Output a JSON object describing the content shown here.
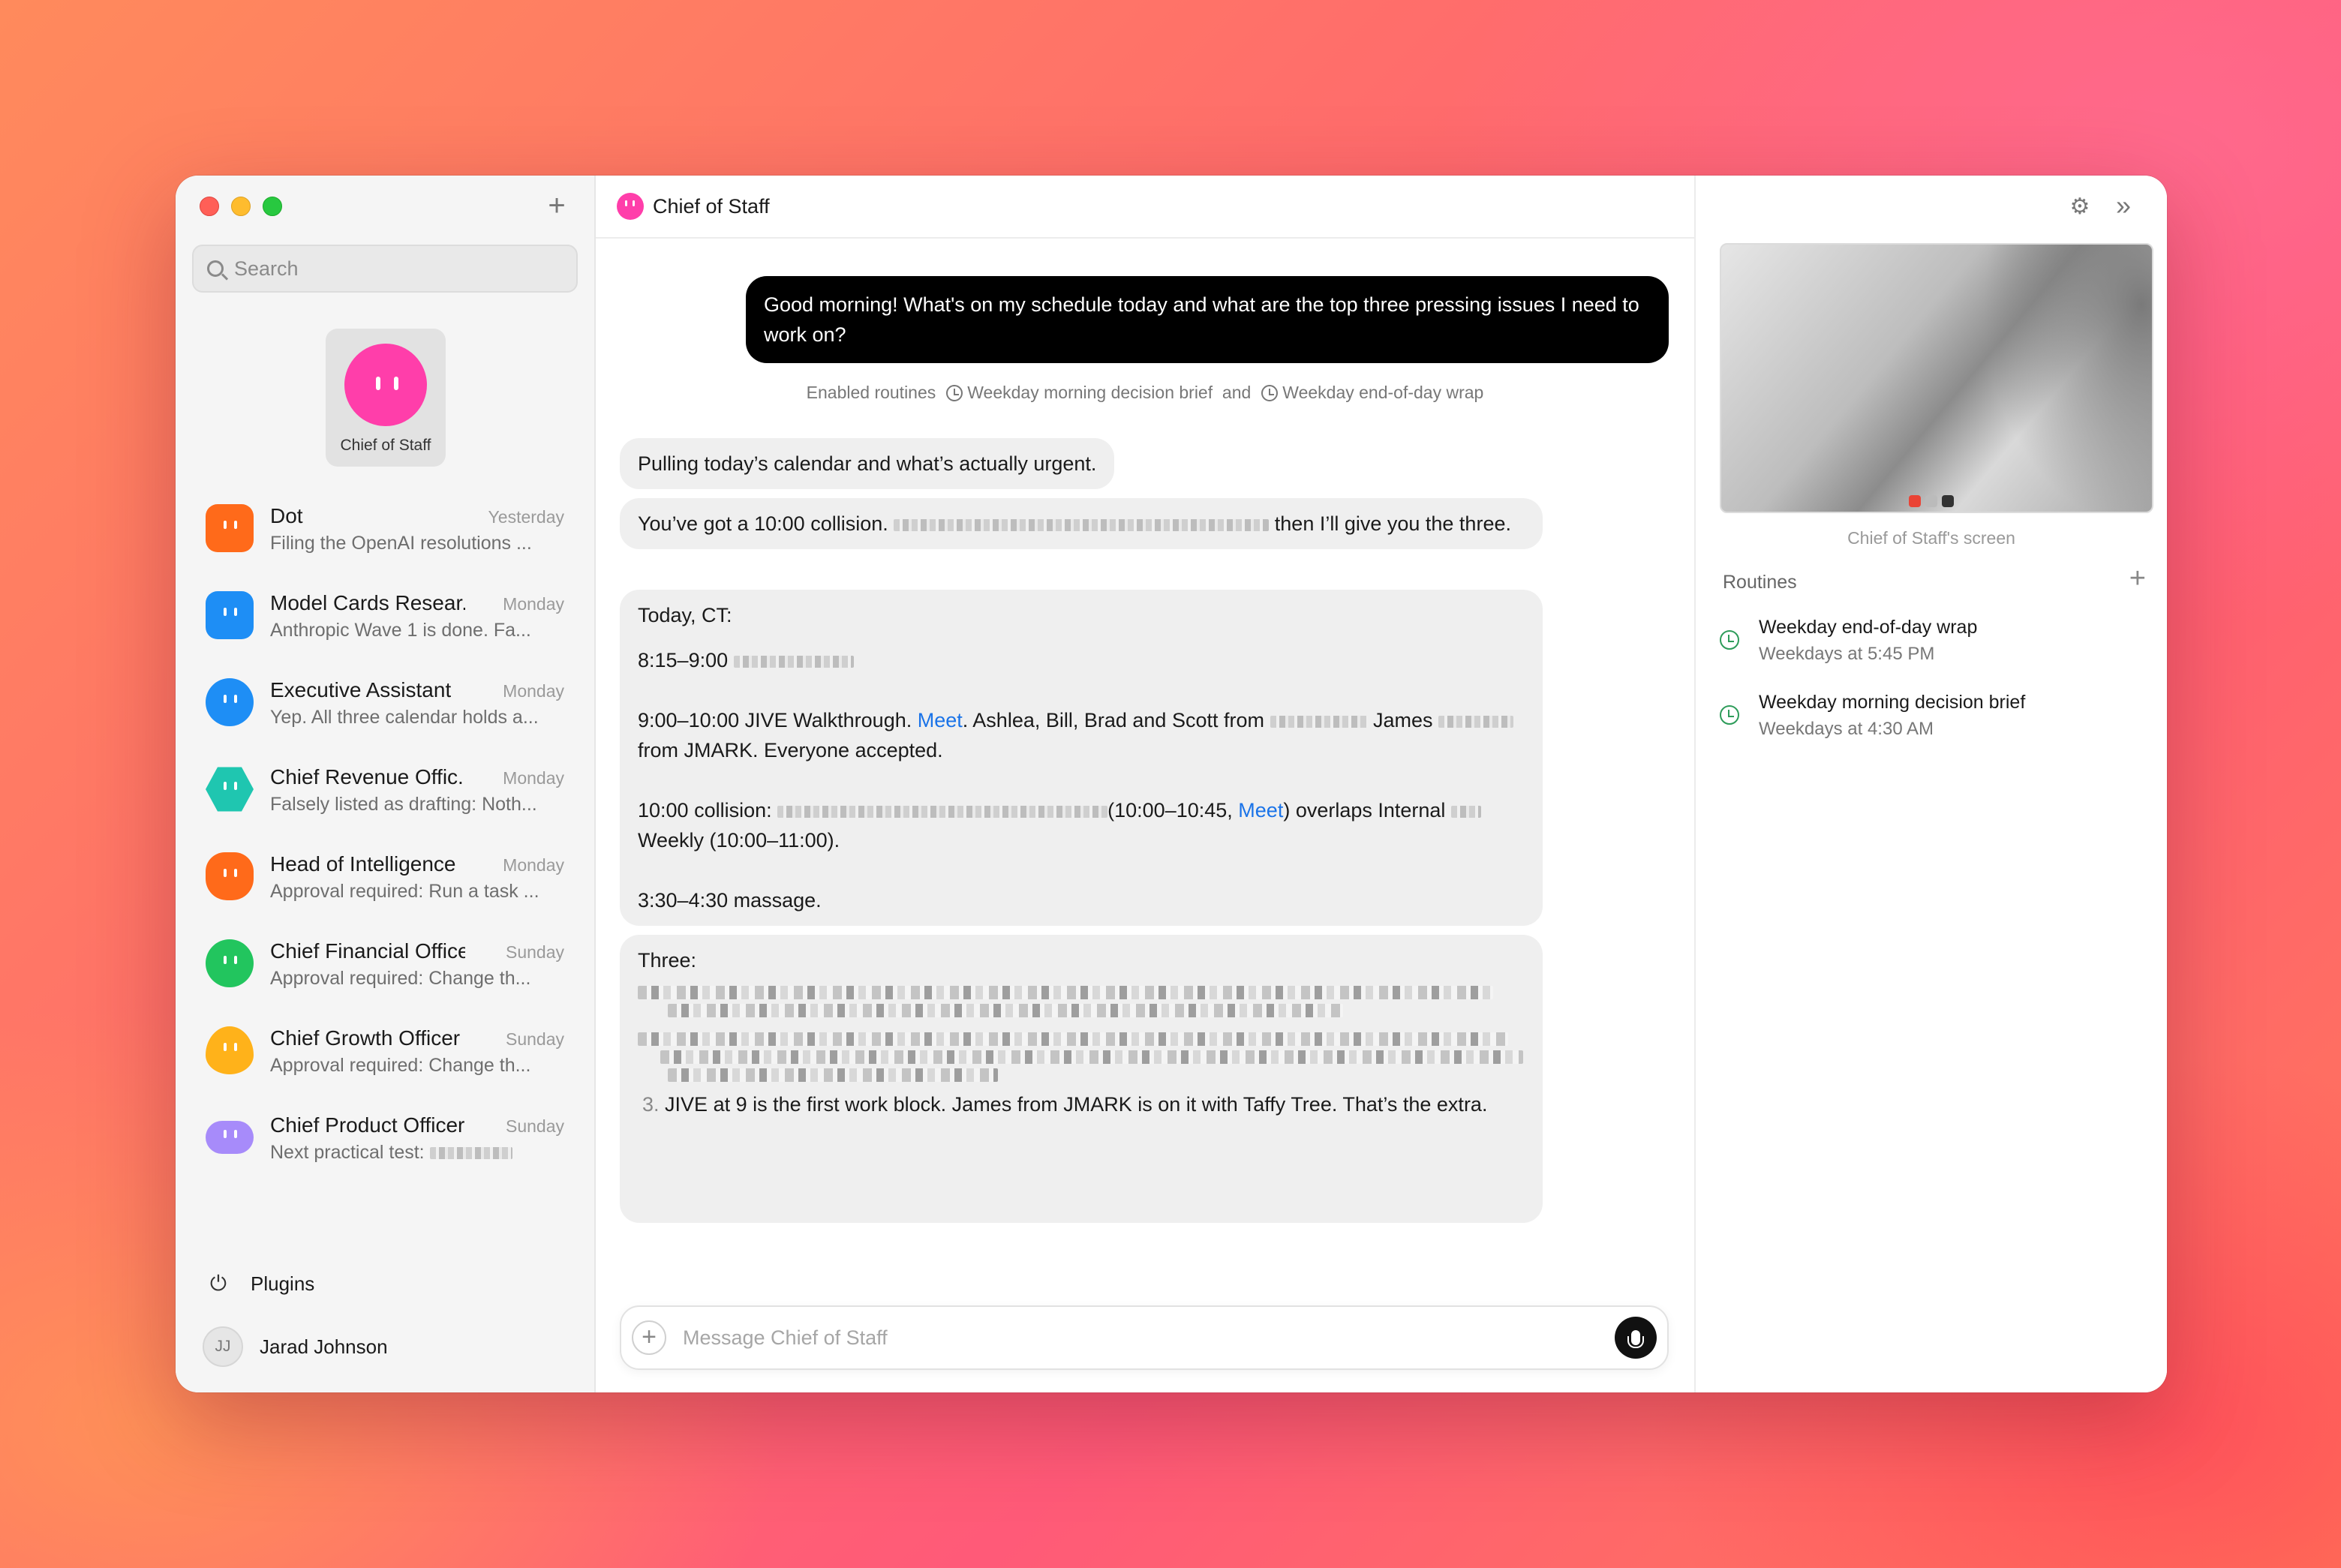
{
  "sidebar": {
    "search_placeholder": "Search",
    "active_agent": {
      "label": "Chief of Staff",
      "color": "#ff3eaa"
    },
    "conversations": [
      {
        "name": "Dot",
        "time": "Yesterday",
        "preview": "Filing the OpenAI resolutions ...",
        "color": "#ff6a1a",
        "shape": "sq"
      },
      {
        "name": "Model Cards Resear...",
        "time": "Monday",
        "preview": "Anthropic Wave 1 is done. Fa...",
        "color": "#1e8ef5",
        "shape": "sq"
      },
      {
        "name": "Executive Assistant",
        "time": "Monday",
        "preview": "Yep. All three calendar holds a...",
        "color": "#1e8ef5",
        "shape": "circle"
      },
      {
        "name": "Chief Revenue Offic...",
        "time": "Monday",
        "preview": "Falsely listed as drafting: Noth...",
        "color": "#1fc6b0",
        "shape": "hex"
      },
      {
        "name": "Head of Intelligence",
        "time": "Monday",
        "preview": "Approval required: Run a task ...",
        "color": "#ff6a1a",
        "shape": "cloud"
      },
      {
        "name": "Chief Financial Officer",
        "time": "Sunday",
        "preview": "Approval required: Change th...",
        "color": "#22c55e",
        "shape": "circle"
      },
      {
        "name": "Chief Growth Officer",
        "time": "Sunday",
        "preview": "Approval required: Change th...",
        "color": "#ffb21a",
        "shape": "drop"
      },
      {
        "name": "Chief Product Officer",
        "time": "Sunday",
        "preview": "Next practical test:",
        "color": "#a78bfa",
        "shape": "pill"
      }
    ],
    "plugins_label": "Plugins",
    "user_initials": "JJ",
    "user_name": "Jarad Johnson"
  },
  "main": {
    "title": "Chief of Staff",
    "user_message": "Good morning! What's on my schedule today and what are the top three pressing issues I need to work on?",
    "routines_note": {
      "prefix": "Enabled routines",
      "routine_a": "Weekday morning decision brief",
      "joiner": "and",
      "routine_b": "Weekday end-of-day wrap"
    },
    "reply_1": "Pulling today’s calendar and what’s actually urgent.",
    "reply_2": {
      "start": "You’ve got a 10:00 collision.",
      "end": "then I’ll give you the three."
    },
    "reply_3": {
      "heading": "Today, CT:",
      "slot_1_time": "8:15–9:00",
      "slot_2_start": "9:00–10:00 JIVE Walkthrough.",
      "meet_label": "Meet",
      "slot_2_mid": ". Ashlea, Bill, Brad and Scott from",
      "slot_2_james": "James",
      "slot_2_end": "from JMARK. Everyone accepted.",
      "collision_start": "10:00 collision:",
      "collision_time": "(10:00–10:45,",
      "collision_end": ") overlaps Internal",
      "collision_weekly": "Weekly (10:00–11:00).",
      "massage": "3:30–4:30 massage."
    },
    "reply_4": {
      "heading": "Three:",
      "item_3_num": "3.",
      "item_3": "JIVE at 9 is the first work block. James from JMARK is on it with Taffy Tree. That’s the extra."
    },
    "composer_placeholder": "Message Chief of Staff"
  },
  "right_panel": {
    "screen_label": "Chief of Staff's screen",
    "routines_title": "Routines",
    "routines": [
      {
        "name": "Weekday end-of-day wrap",
        "schedule": "Weekdays at 5:45 PM"
      },
      {
        "name": "Weekday morning decision brief",
        "schedule": "Weekdays at 4:30 AM"
      }
    ]
  }
}
